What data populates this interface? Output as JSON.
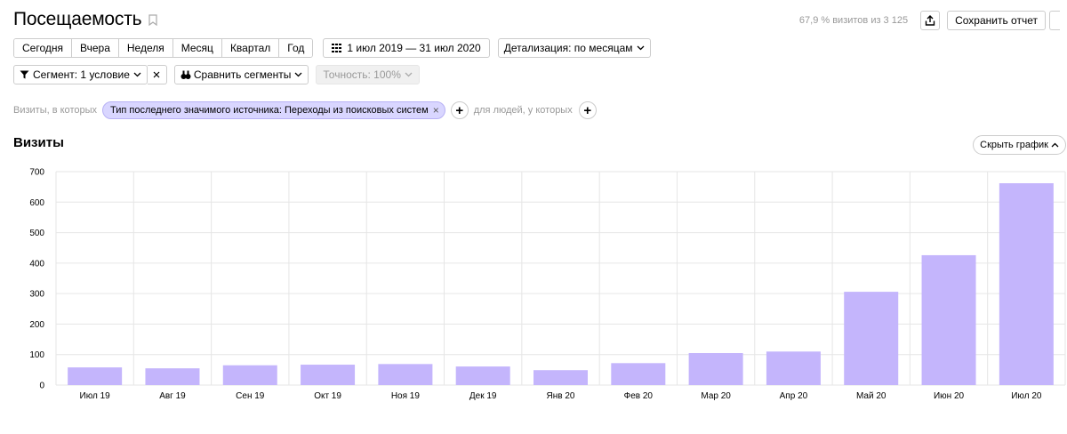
{
  "header": {
    "title": "Посещаемость",
    "visits_info": "67,9 % визитов из 3 125",
    "save_label": "Сохранить отчет"
  },
  "periods": [
    {
      "label": "Сегодня"
    },
    {
      "label": "Вчера"
    },
    {
      "label": "Неделя"
    },
    {
      "label": "Месяц"
    },
    {
      "label": "Квартал"
    },
    {
      "label": "Год"
    }
  ],
  "date_range": "1 июл 2019 — 31 июл 2020",
  "detail": "Детализация: по месяцам",
  "segment": {
    "label": "Сегмент: 1 условие",
    "compare_label": "Сравнить сегменты",
    "accuracy_label": "Точность: 100%"
  },
  "filter": {
    "prefix": "Визиты, в которых",
    "chip_label": "Тип последнего значимого источника: Переходы из поисковых систем",
    "people_label": "для людей, у которых"
  },
  "section": {
    "title": "Визиты",
    "hide_chart_label": "Скрыть график"
  },
  "colors": {
    "bar": "#c4b5fc",
    "grid": "#e6e6e6",
    "chip_bg": "#d9d6ff"
  },
  "chart_data": {
    "type": "bar",
    "categories": [
      "Июл 19",
      "Авг 19",
      "Сен 19",
      "Окт 19",
      "Ноя 19",
      "Дек 19",
      "Янв 20",
      "Фев 20",
      "Мар 20",
      "Апр 20",
      "Май 20",
      "Июн 20",
      "Июл 20"
    ],
    "series": [
      {
        "values": [
          58,
          55,
          65,
          67,
          69,
          61,
          49,
          72,
          105,
          110,
          306,
          426,
          662
        ]
      }
    ],
    "yticks": [
      0,
      100,
      200,
      300,
      400,
      500,
      600,
      700
    ],
    "ylim": [
      0,
      700
    ],
    "grid": true
  }
}
